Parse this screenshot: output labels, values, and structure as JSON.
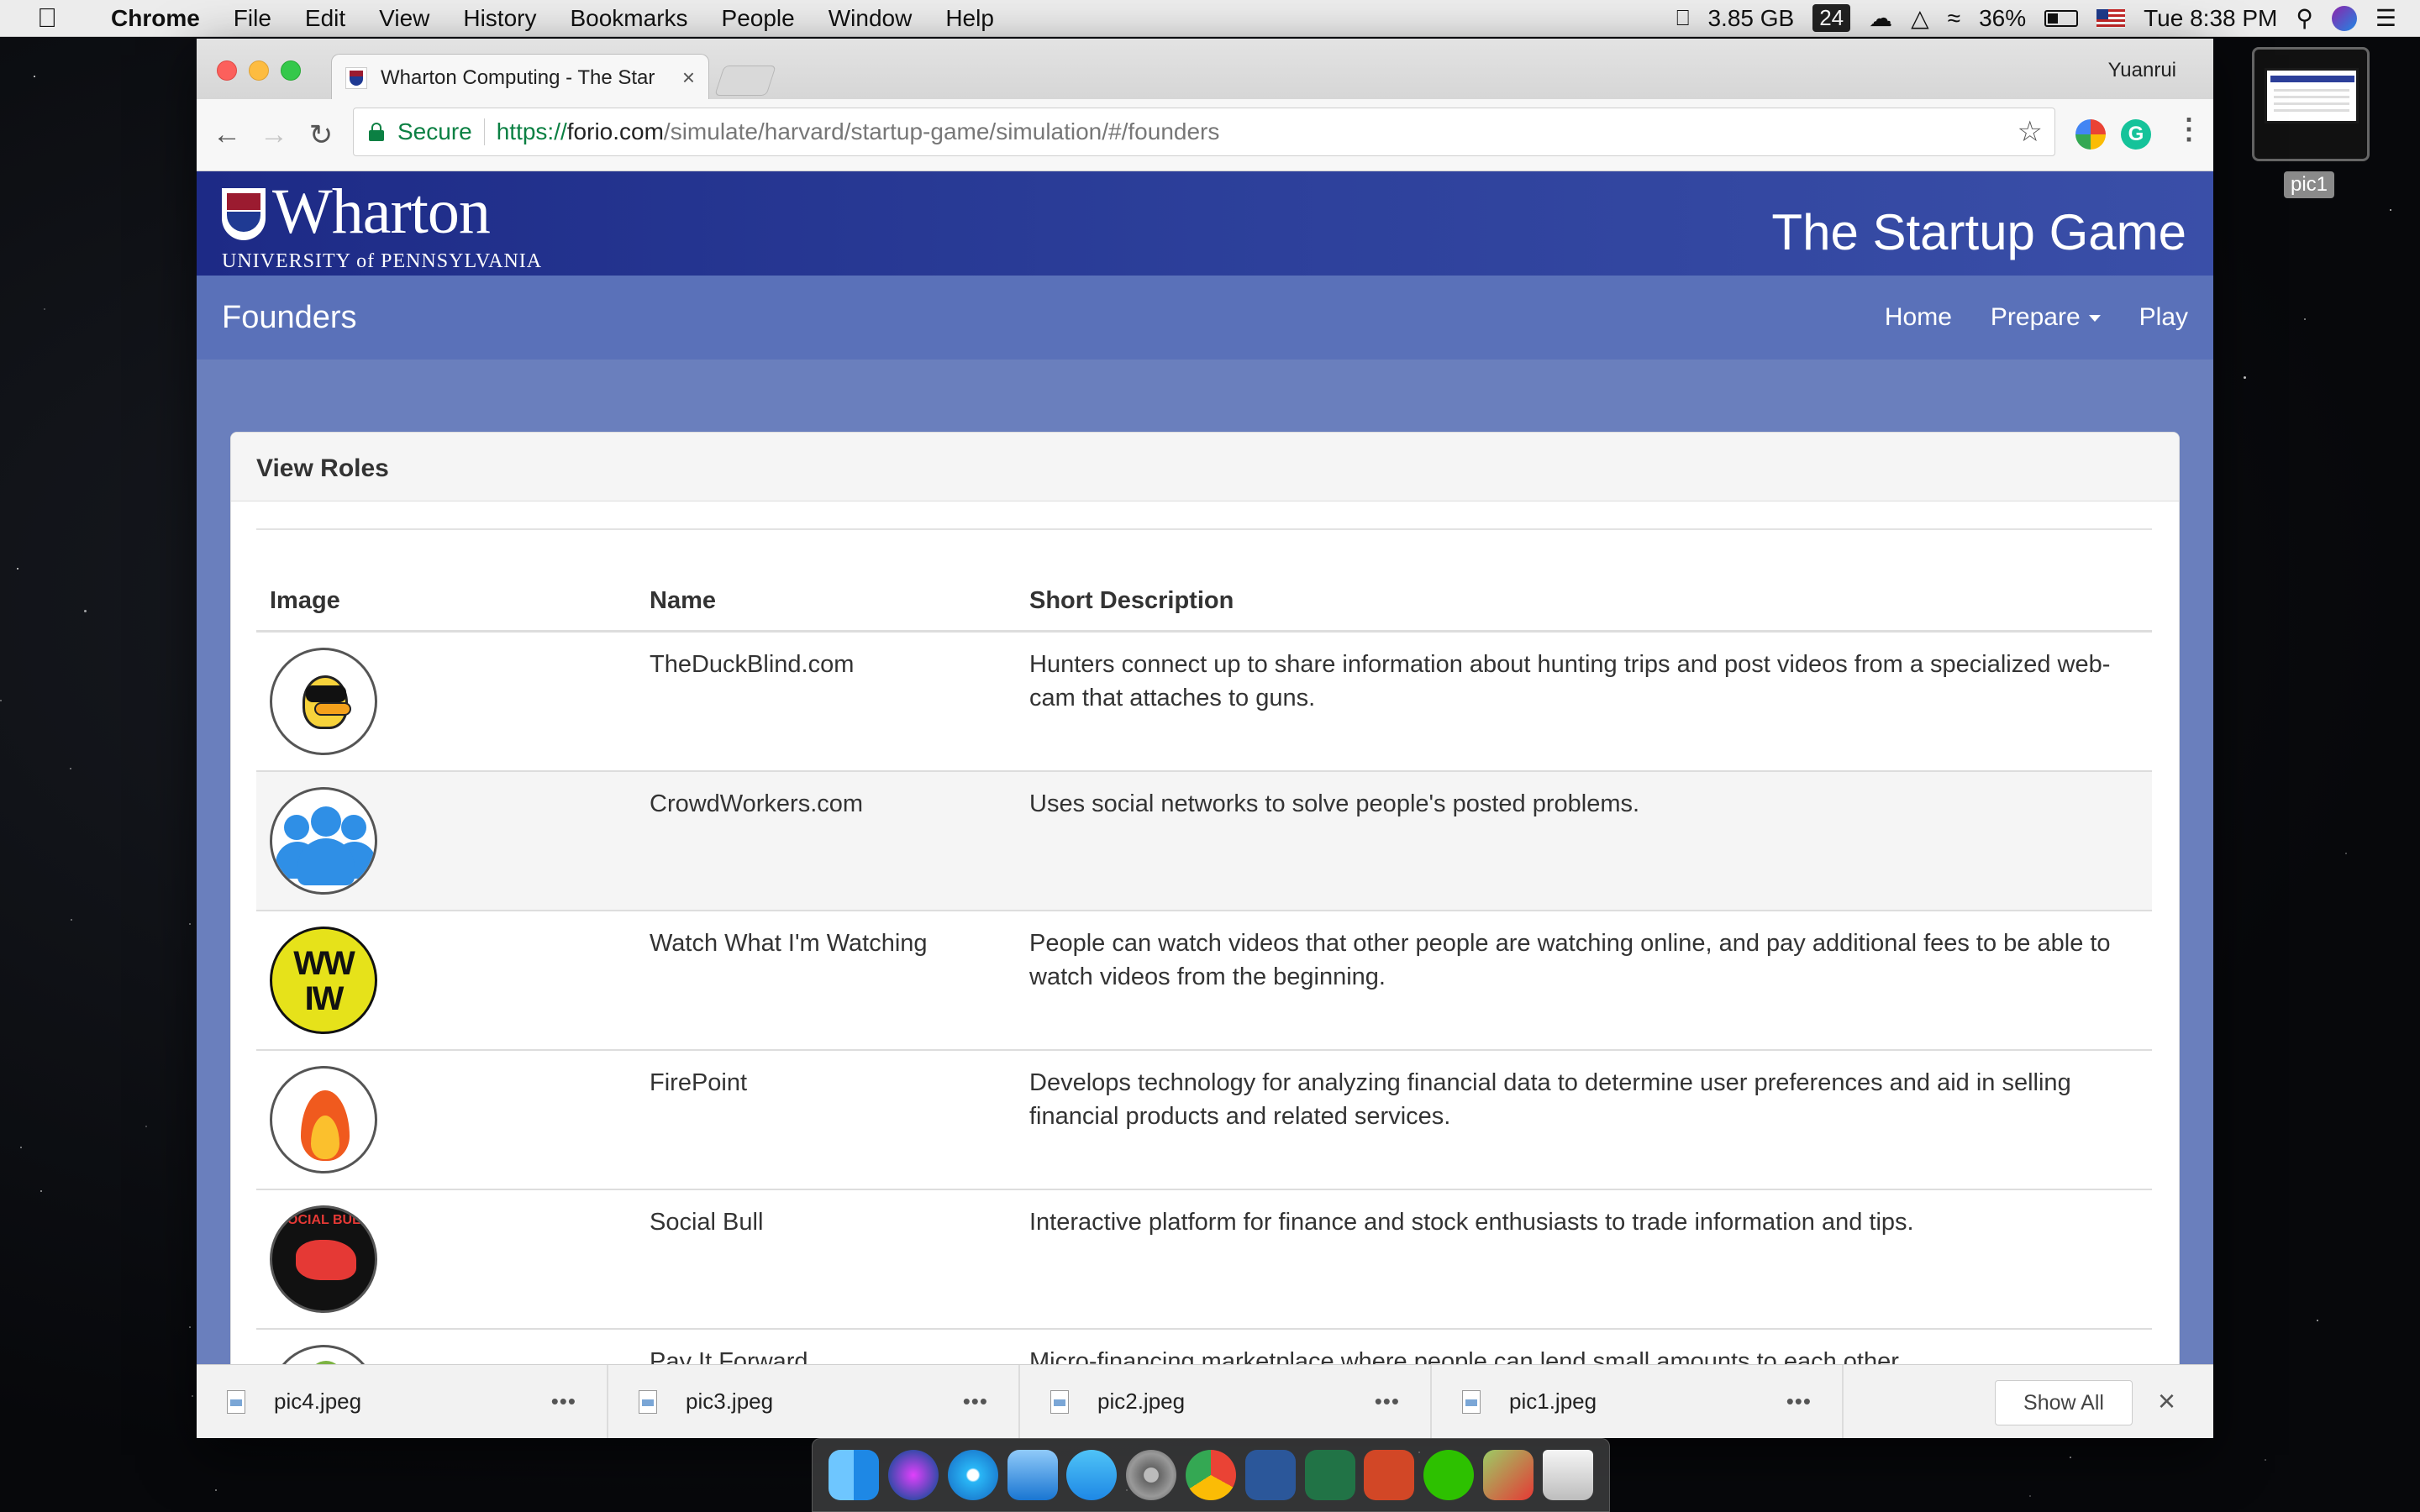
{
  "menubar": {
    "app_name": "Chrome",
    "menus": [
      "File",
      "Edit",
      "View",
      "History",
      "Bookmarks",
      "People",
      "Window",
      "Help"
    ],
    "memory": "3.85 GB",
    "badge": "24",
    "battery": "36%",
    "clock": "Tue 8:38 PM"
  },
  "browser": {
    "tab_title": "Wharton Computing - The Star",
    "profile_name": "Yuanrui",
    "secure_label": "Secure",
    "url_scheme": "https://",
    "url_host": "forio.com",
    "url_path": "/simulate/harvard/startup-game/simulation/#/founders"
  },
  "site": {
    "logo_text": "Wharton",
    "logo_sub": "UNIVERSITY of PENNSYLVANIA",
    "game_title": "The Startup Game",
    "nav_brand": "Founders",
    "nav_links": [
      "Home",
      "Prepare",
      "Play"
    ]
  },
  "panel": {
    "heading": "View Roles",
    "columns": [
      "Image",
      "Name",
      "Short Description"
    ],
    "rows": [
      {
        "name": "TheDuckBlind.com",
        "description": "Hunters connect up to share information about hunting trips and post videos from a specialized web-cam that attaches to guns.",
        "image": "duck-logo"
      },
      {
        "name": "CrowdWorkers.com",
        "description": "Uses social networks to solve people's posted problems.",
        "image": "crowd-logo"
      },
      {
        "name": "Watch What I'm Watching",
        "description": "People can watch videos that other people are watching online, and pay additional fees to be able to watch videos from the beginning.",
        "image": "wwiw-logo",
        "image_text": "WW IW"
      },
      {
        "name": "FirePoint",
        "description": "Develops technology for analyzing financial data to determine user preferences and aid in selling financial products and related services.",
        "image": "fire-logo"
      },
      {
        "name": "Social Bull",
        "description": "Interactive platform for finance and stock enthusiasts to trade information and tips.",
        "image": "bull-logo",
        "image_text": "SOCIAL BULL"
      },
      {
        "name": "Pay It Forward",
        "description": "Micro-financing marketplace where people can lend small amounts to each other.",
        "image": "pay-logo"
      }
    ]
  },
  "downloads": {
    "files": [
      "pic4.jpeg",
      "pic3.jpeg",
      "pic2.jpeg",
      "pic1.jpeg"
    ],
    "show_all": "Show All"
  },
  "desktop": {
    "thumbnail_label": "pic1"
  }
}
